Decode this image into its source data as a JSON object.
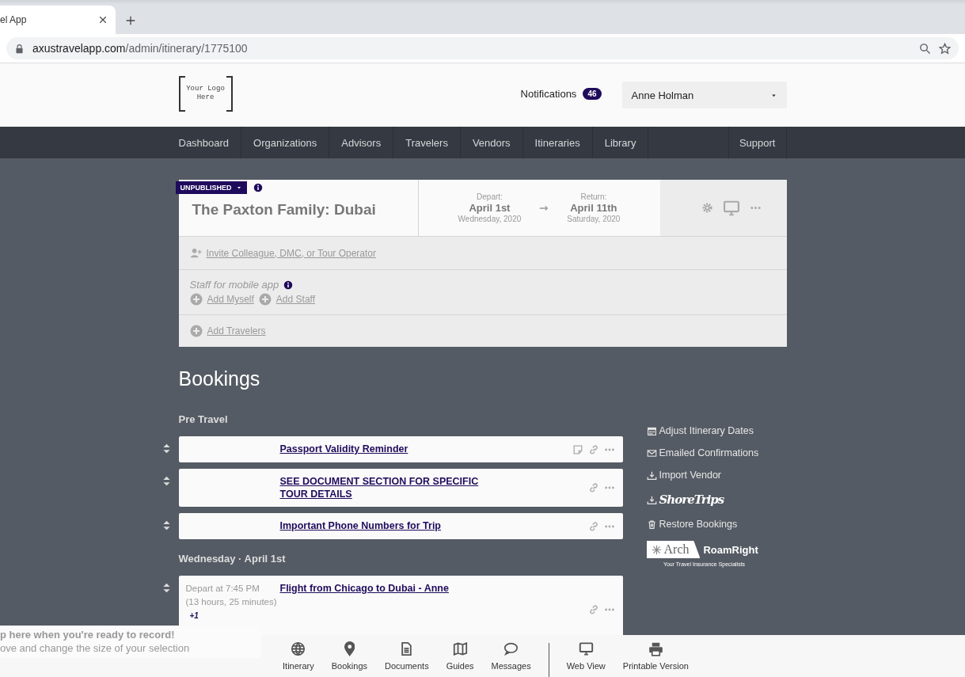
{
  "browser": {
    "tab_title": "el App",
    "url_domain": "axustravelapp.com",
    "url_path": "/admin/itinerary/1775100"
  },
  "header": {
    "logo_lines": [
      "Your Logo",
      "Here"
    ],
    "notifications_label": "Notifications",
    "notifications_count": "46",
    "user": "Anne Holman"
  },
  "nav": {
    "items": [
      "Dashboard",
      "Organizations",
      "Advisors",
      "Travelers",
      "Vendors",
      "Itineraries",
      "Library"
    ],
    "secondary": [
      "Support"
    ]
  },
  "trip": {
    "status": "UNPUBLISHED",
    "title": "The Paxton Family: Dubai",
    "depart": {
      "label": "Depart:",
      "date": "April 1st",
      "day": "Wednesday, 2020"
    },
    "return": {
      "label": "Return:",
      "date": "April 11th",
      "day": "Saturday, 2020"
    },
    "invite": "Invite Colleague, DMC, or Tour Operator",
    "staff_label": "Staff for mobile app",
    "staff_actions": [
      "Add Myself",
      "Add Staff"
    ],
    "add_travelers": "Add Travelers"
  },
  "bookings": {
    "title": "Bookings",
    "groups": [
      {
        "heading": "Pre Travel",
        "items": [
          {
            "title": "Passport Validity Reminder",
            "note": true
          },
          {
            "title": "SEE DOCUMENT SECTION FOR SPECIFIC TOUR DETAILS",
            "note": false
          },
          {
            "title": "Important Phone Numbers for Trip",
            "note": false
          }
        ]
      },
      {
        "heading": "Wednesday · April 1st",
        "items": [
          {
            "title": "Flight from Chicago to Dubai - Anne",
            "note": false,
            "time": "Depart at 7:45 PM",
            "duration": "(13 hours, 25 minutes)",
            "day_offset": "+1"
          }
        ]
      }
    ]
  },
  "sidebar_actions": [
    {
      "kind": "link",
      "label": "Adjust Itinerary Dates"
    },
    {
      "kind": "link",
      "label": "Emailed Confirmations"
    },
    {
      "kind": "link",
      "label": "Import Vendor"
    },
    {
      "kind": "brand",
      "label": "ShoreTrips"
    },
    {
      "kind": "link",
      "label": "Restore Bookings"
    }
  ],
  "partner_logo": {
    "left": "Arch",
    "right": "RoamRight",
    "tagline": "Your Travel Insurance Specialists"
  },
  "bottom_bar": [
    {
      "label": "Itinerary"
    },
    {
      "label": "Bookings"
    },
    {
      "label": "Documents"
    },
    {
      "label": "Guides"
    },
    {
      "label": "Messages"
    },
    {
      "label": "Web View"
    },
    {
      "label": "Printable Version"
    }
  ],
  "recorder_overlay": [
    "p here when you're ready to record!",
    "ove and change the size of your selection"
  ]
}
